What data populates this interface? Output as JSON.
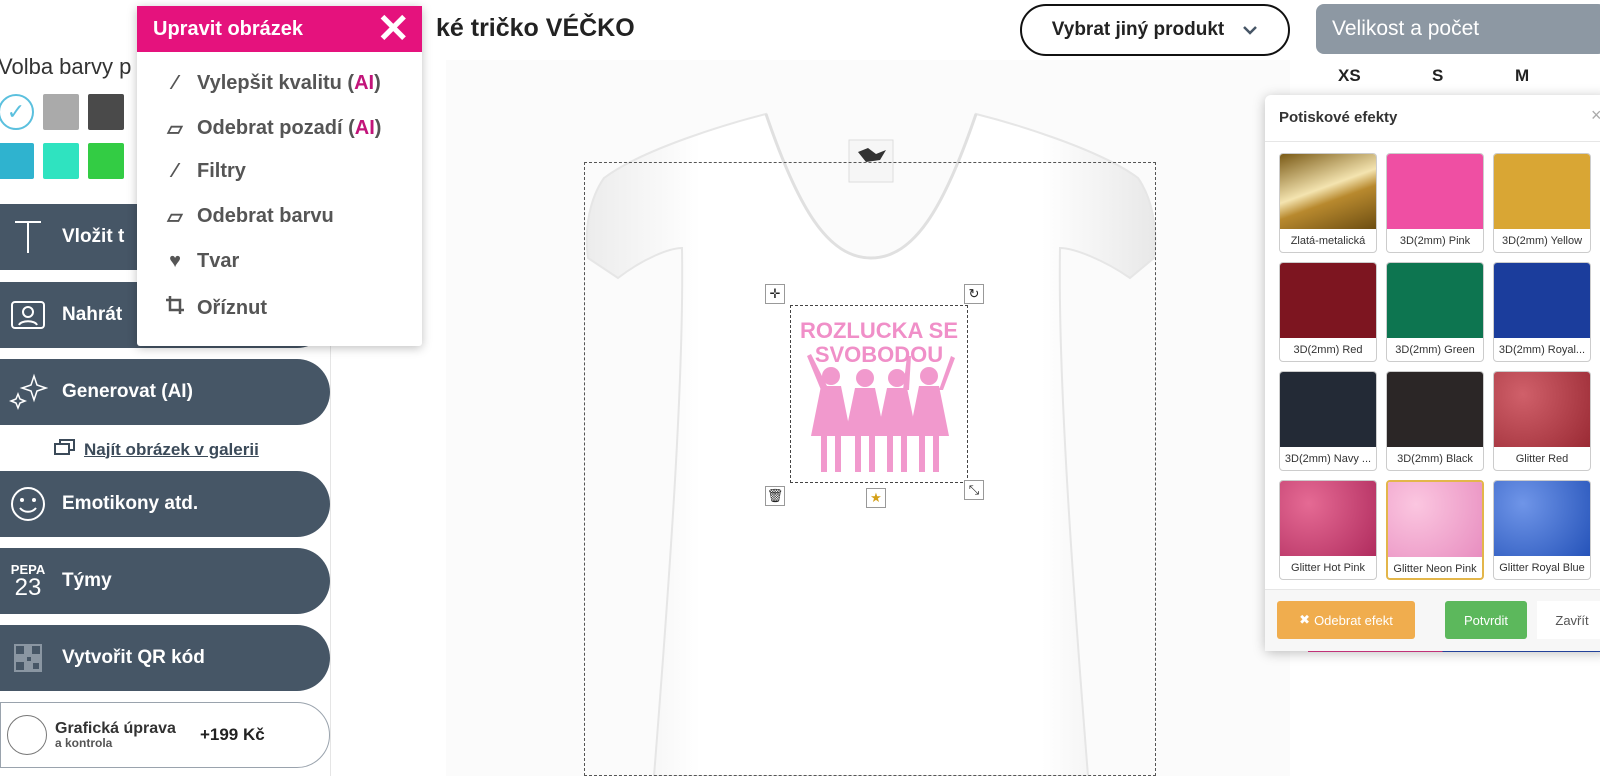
{
  "sidebar": {
    "color_label": "Volba barvy p",
    "colors": [
      "#ffffff",
      "#aaaaaa",
      "#4a4a4a",
      "#2fb3cf",
      "#2fe3c0",
      "#33cc44"
    ],
    "buttons": [
      {
        "id": "insert-text",
        "label": "Vložit t",
        "icon": "text-icon"
      },
      {
        "id": "upload",
        "label": "Nahrát",
        "icon": "portrait-icon"
      },
      {
        "id": "generate",
        "label": "Generovat (AI)",
        "icon": "sparkle-icon"
      },
      {
        "id": "emoticons",
        "label": "Emotikony atd.",
        "icon": "smiley-icon"
      },
      {
        "id": "teams",
        "label": "Týmy",
        "icon": "team-number-icon"
      },
      {
        "id": "qr",
        "label": "Vytvořit QR kód",
        "icon": "qr-icon"
      }
    ],
    "teams_icon_top": "PEPA",
    "teams_icon_number": "23",
    "gallery_link": "Najít obrázek v galerii",
    "graphic": {
      "title": "Grafická úprava",
      "subtitle": "a kontrola",
      "price": "+199 Kč"
    }
  },
  "edit_menu": {
    "title": "Upravit obrázek",
    "close": "✕",
    "items": [
      {
        "label": "Vylepšit kvalitu (",
        "ai": "AI",
        "suffix": ")",
        "icon": "magic-wand-icon"
      },
      {
        "label": "Odebrat pozadí (",
        "ai": "AI",
        "suffix": ")",
        "icon": "eraser-icon"
      },
      {
        "label": "Filtry",
        "ai": "",
        "suffix": "",
        "icon": "magic-wand-icon"
      },
      {
        "label": "Odebrat barvu",
        "ai": "",
        "suffix": "",
        "icon": "eraser-icon"
      },
      {
        "label": "Tvar",
        "ai": "",
        "suffix": "",
        "icon": "heart-icon"
      },
      {
        "label": "Oříznut",
        "ai": "",
        "suffix": "",
        "icon": "crop-icon"
      }
    ]
  },
  "header": {
    "product_title": "ké tričko VÉČKO",
    "choose_product": "Vybrat jiný produkt",
    "size_header": "Velikost a počet",
    "sizes": [
      "XS",
      "S",
      "M"
    ]
  },
  "design": {
    "text_line1": "ROZLUCKA SE",
    "text_line2": "SVOBODOU",
    "color": "#f08fc8"
  },
  "effects": {
    "title": "Potiskové efekty",
    "close": "×",
    "items": [
      {
        "name": "Zlatá-metalická",
        "color": "linear-gradient(160deg,#7a5a16 0%,#f4e4b0 45%,#b8892e 60%,#6d4e12 100%)"
      },
      {
        "name": "3D(2mm) Pink",
        "color": "#ef4fa3"
      },
      {
        "name": "3D(2mm) Yellow",
        "color": "#d9a634"
      },
      {
        "name": "3D(2mm) Red",
        "color": "#7d1520"
      },
      {
        "name": "3D(2mm) Green",
        "color": "#0d7550"
      },
      {
        "name": "3D(2mm) Royal...",
        "color": "#1b3d9c"
      },
      {
        "name": "3D(2mm) Navy ...",
        "color": "#232a36"
      },
      {
        "name": "3D(2mm) Black",
        "color": "#2b2626"
      },
      {
        "name": "Glitter Red",
        "color": "radial-gradient(circle at 30% 30%,#d0606a,#9a2a34)"
      },
      {
        "name": "Glitter Hot Pink",
        "color": "radial-gradient(circle at 30% 30%,#e56a94,#b02c5e)"
      },
      {
        "name": "Glitter Neon Pink",
        "color": "radial-gradient(circle at 30% 30%,#fbc6e0,#e88ec0)"
      },
      {
        "name": "Glitter Royal Blue",
        "color": "radial-gradient(circle at 30% 30%,#6f95e8,#2553b9)"
      }
    ],
    "selected_index": 10,
    "remove_label": "Odebrat efekt",
    "confirm_label": "Potvrdit",
    "close_label": "Zavřít"
  }
}
